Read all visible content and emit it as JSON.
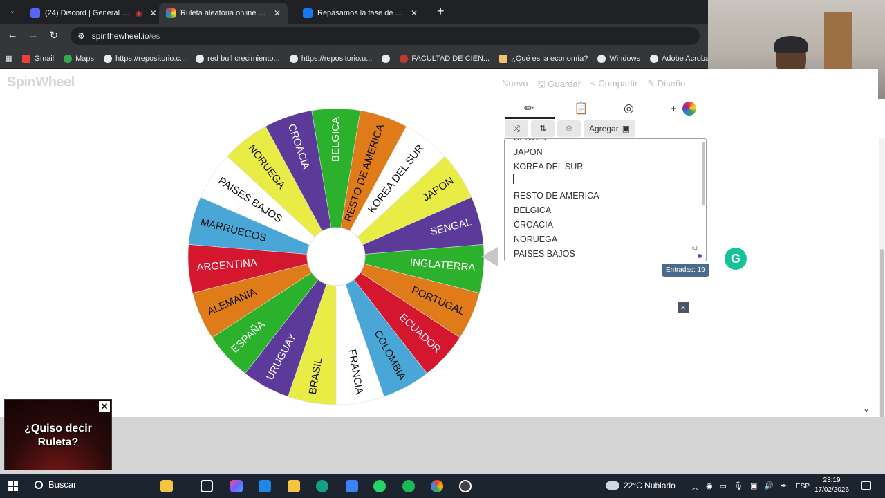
{
  "browser": {
    "tabs": [
      {
        "title": "(24) Discord | General | Con",
        "fav_color": "#5865f2",
        "active": false
      },
      {
        "title": "Ruleta aleatoria online – ruleta",
        "fav_color": "#e94f8a",
        "active": true
      },
      {
        "title": "Repasamos la fase de clasificaci",
        "fav_color": "#1877f2",
        "active": false
      }
    ],
    "url_host": "spinthewheel.io",
    "url_path": "/es",
    "bookmarks": [
      "Gmail",
      "Maps",
      "https://repositorio.c...",
      "red bull crecimiento...",
      "https://repositorio.u...",
      "",
      "FACULTAD DE CIEN...",
      "¿Qué es la economía?",
      "Windows",
      "Adobe Acrobat"
    ]
  },
  "app": {
    "logo": "SpinWheel",
    "menu": [
      "Nuevo",
      "Guardar",
      "Compartir",
      "Diseño"
    ],
    "add_image_label": "Agregar",
    "entries_visible": [
      "SENGAL",
      "JAPON",
      "KOREA DEL SUR",
      "",
      "RESTO DE AMERICA",
      "BELGICA",
      "CROACIA",
      "NORUEGA",
      "PAISES BAJOS"
    ],
    "entries_count": "Entradas: 19",
    "close_glyph": "×"
  },
  "wheel": {
    "segments": [
      {
        "label": "BELGICA",
        "color": "#2bb12b"
      },
      {
        "label": "RESTO DE AMERICA",
        "color": "#e07b1a"
      },
      {
        "label": "KOREA DEL SUR",
        "color": "#ffffff"
      },
      {
        "label": "JAPON",
        "color": "#e8ec45"
      },
      {
        "label": "SENGAL",
        "color": "#5b3a99"
      },
      {
        "label": "INGLATERRA",
        "color": "#2bb12b"
      },
      {
        "label": "PORTUGAL",
        "color": "#e07b1a"
      },
      {
        "label": "ECUADOR",
        "color": "#d4172f"
      },
      {
        "label": "COLOMBIA",
        "color": "#4aa6d6"
      },
      {
        "label": "FRANCIA",
        "color": "#ffffff"
      },
      {
        "label": "BRASIL",
        "color": "#e8ec45"
      },
      {
        "label": "URUGUAY",
        "color": "#5b3a99"
      },
      {
        "label": "ESPAÑA",
        "color": "#2bb12b"
      },
      {
        "label": "ALEMANIA",
        "color": "#e07b1a"
      },
      {
        "label": "ARGENTINA",
        "color": "#d4172f"
      },
      {
        "label": "MARRUECOS",
        "color": "#4aa6d6"
      },
      {
        "label": "PAISES BAJOS",
        "color": "#ffffff"
      },
      {
        "label": "NORUEGA",
        "color": "#e8ec45"
      },
      {
        "label": "CROACIA",
        "color": "#5b3a99"
      }
    ]
  },
  "ad": {
    "text_line1": "¿Quiso decir",
    "text_line2": "Ruleta?"
  },
  "taskbar": {
    "search_label": "Buscar",
    "weather": "22°C Nublado",
    "lang": "ESP",
    "time": "23:19",
    "date": "17/02/2026"
  }
}
